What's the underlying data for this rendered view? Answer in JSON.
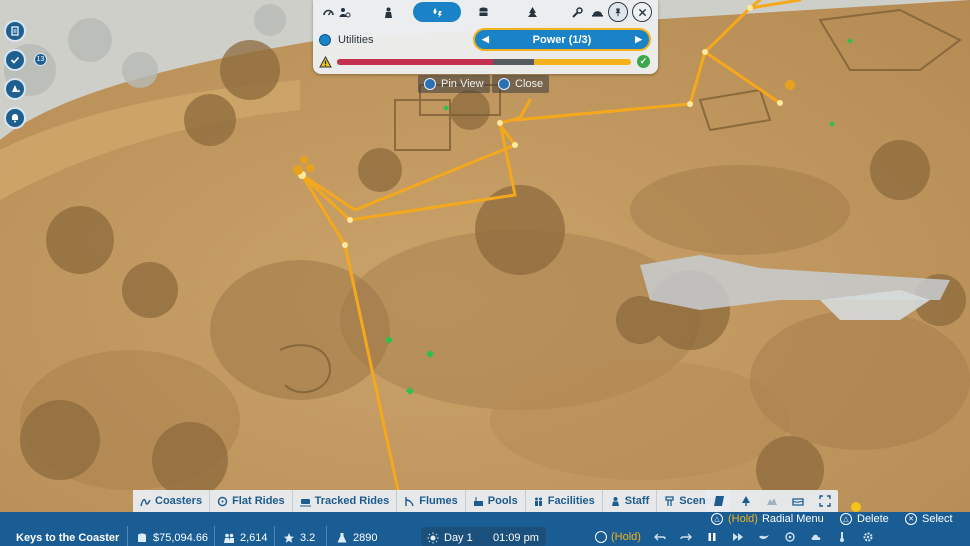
{
  "utilities_panel": {
    "category_label": "Utilities",
    "selector_value": "Power (1/3)",
    "tabs": [
      "dashboard-icon",
      "rides-icon",
      "guests-icon",
      "utilities-icon",
      "finance-icon",
      "scenery-icon",
      "tools-icon",
      "hardhat-icon",
      "pin-icon",
      "close-icon"
    ],
    "status_bar": {
      "red_fraction": 0.53,
      "grey_fraction": 0.14,
      "yellow_fraction": 0.33
    },
    "pin_view_label": "Pin View",
    "close_label": "Close"
  },
  "categories": [
    {
      "label": "Coasters",
      "icon": "coaster-icon"
    },
    {
      "label": "Flat Rides",
      "icon": "flatride-icon"
    },
    {
      "label": "Tracked Rides",
      "icon": "tracked-icon"
    },
    {
      "label": "Flumes",
      "icon": "flume-icon"
    },
    {
      "label": "Pools",
      "icon": "pool-icon"
    },
    {
      "label": "Facilities",
      "icon": "facility-icon"
    },
    {
      "label": "Staff",
      "icon": "staff-icon"
    },
    {
      "label": "Scenery",
      "icon": "scenery-icon"
    }
  ],
  "status": {
    "park_name": "Keys to the Coaster",
    "money": "$75,094.66",
    "guests": "2,614",
    "rating": "3.2",
    "research": "2890",
    "day": "Day 1",
    "time": "01:09 pm"
  },
  "controls": {
    "radial_hold": "(Hold)",
    "radial_label": "Radial Menu",
    "delete_label": "Delete",
    "select_label": "Select",
    "pause_hold": "(Hold)"
  },
  "left_badge": "13",
  "colors": {
    "accent": "#1a82c7",
    "highlight": "#f3b21b",
    "status_bar": "#195d94",
    "power_line": "#f5a81c"
  }
}
